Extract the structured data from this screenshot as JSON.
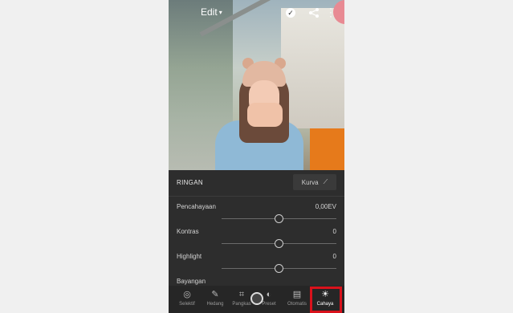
{
  "header": {
    "title": "Edit",
    "check_icon": "check-circle-icon",
    "share_icon": "share-icon",
    "more_icon": "more-vertical-icon"
  },
  "panel": {
    "title": "RINGAN",
    "kurva_label": "Kurva",
    "kurva_icon": "curve-icon",
    "sliders": [
      {
        "label": "Pencahayaan",
        "value": "0,00EV",
        "level": 0.5
      },
      {
        "label": "Kontras",
        "value": "0",
        "level": 0.5
      },
      {
        "label": "Highlight",
        "value": "0",
        "level": 0.5
      },
      {
        "label": "Bayangan",
        "value": "",
        "level": 0.5
      }
    ]
  },
  "toolbar": {
    "items": [
      {
        "label": "Selektif",
        "icon": "selective-icon"
      },
      {
        "label": "Hedang",
        "icon": "healing-icon"
      },
      {
        "label": "Pangkas",
        "icon": "crop-icon"
      },
      {
        "label": "Preset",
        "icon": "preset-icon"
      },
      {
        "label": "Otomatis",
        "icon": "auto-icon"
      },
      {
        "label": "Cahaya",
        "icon": "light-sun-icon",
        "active": true
      }
    ]
  },
  "colors": {
    "highlight_border": "#d9121c",
    "panel_bg": "#2d2d2d",
    "page_bg": "#f0f0f0"
  }
}
